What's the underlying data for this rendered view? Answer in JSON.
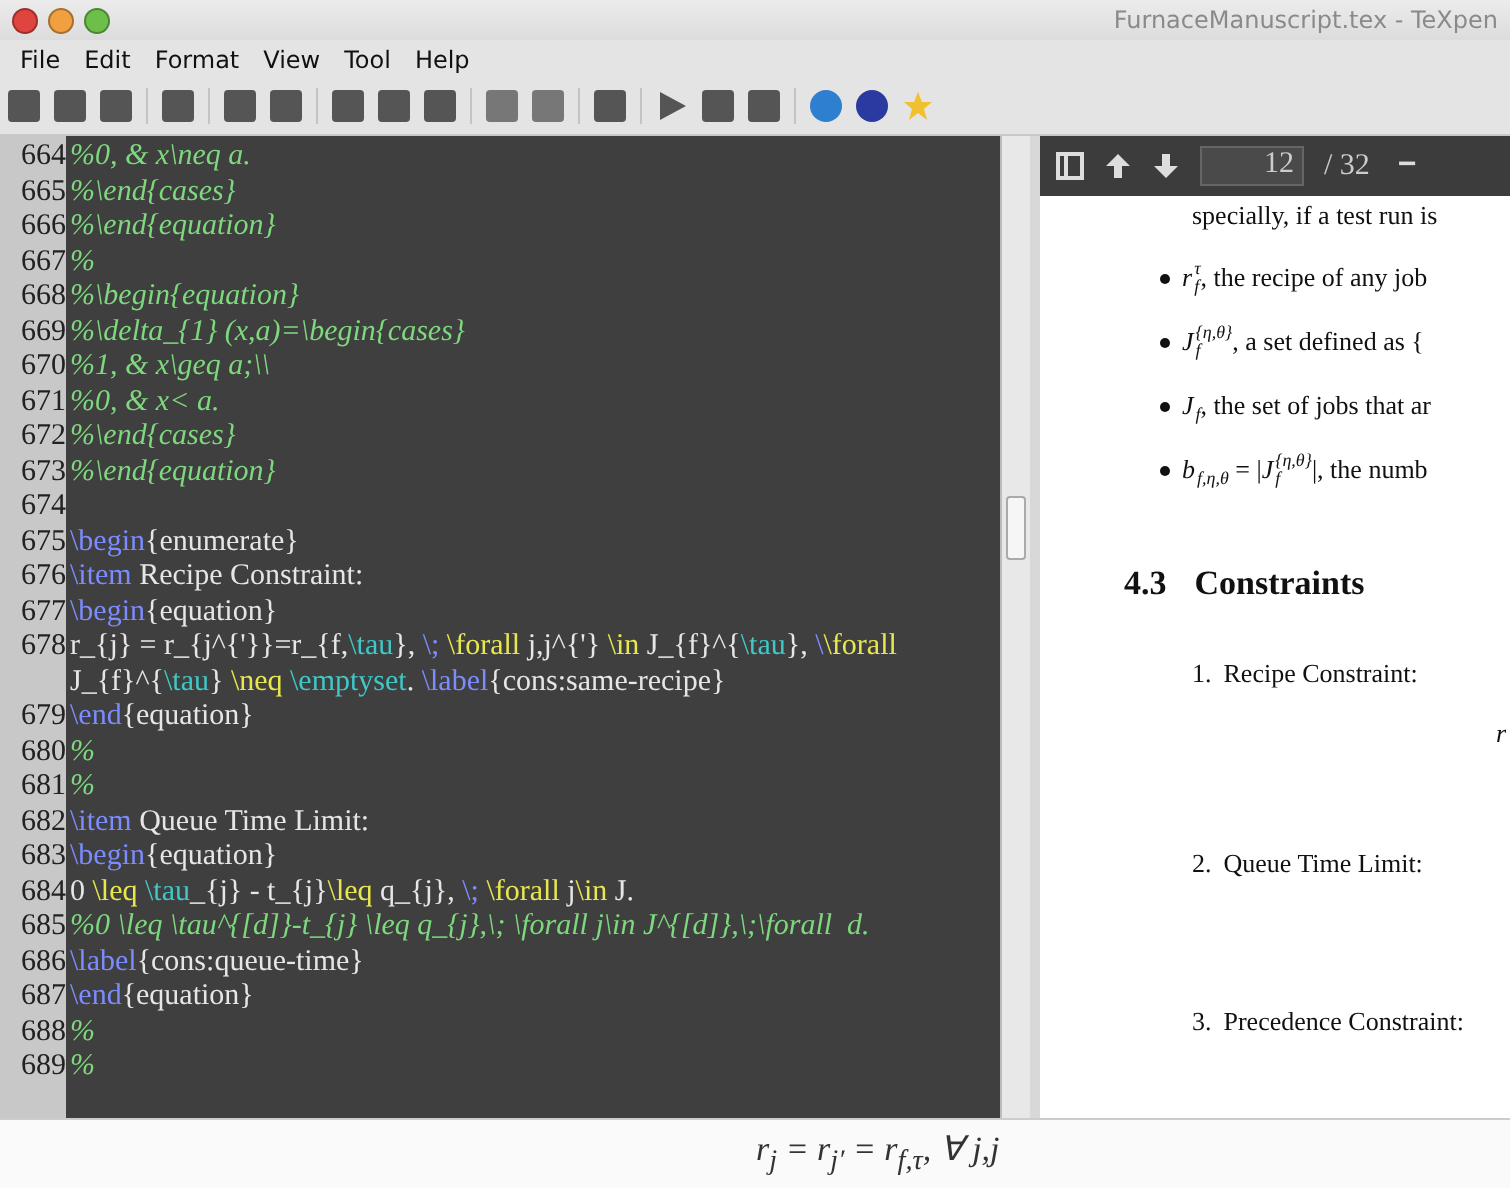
{
  "window": {
    "title": "FurnaceManuscript.tex - TeXpen"
  },
  "menu": [
    "File",
    "Edit",
    "Format",
    "View",
    "Tool",
    "Help"
  ],
  "editor": {
    "lines": [
      {
        "number": "664",
        "segments": [
          {
            "kind": "comment",
            "text": "%0, & x\\neq a."
          }
        ]
      },
      {
        "number": "665",
        "segments": [
          {
            "kind": "comment",
            "text": "%\\end{cases}"
          }
        ]
      },
      {
        "number": "666",
        "segments": [
          {
            "kind": "comment",
            "text": "%\\end{equation}"
          }
        ]
      },
      {
        "number": "667",
        "segments": [
          {
            "kind": "comment",
            "text": "%"
          }
        ]
      },
      {
        "number": "668",
        "segments": [
          {
            "kind": "comment",
            "text": "%\\begin{equation}"
          }
        ]
      },
      {
        "number": "669",
        "segments": [
          {
            "kind": "comment",
            "text": "%\\delta_{1} (x,a)=\\begin{cases}"
          }
        ]
      },
      {
        "number": "670",
        "segments": [
          {
            "kind": "comment",
            "text": "%1, & x\\geq a;\\\\"
          }
        ]
      },
      {
        "number": "671",
        "segments": [
          {
            "kind": "comment",
            "text": "%0, & x< a."
          }
        ]
      },
      {
        "number": "672",
        "segments": [
          {
            "kind": "comment",
            "text": "%\\end{cases}"
          }
        ]
      },
      {
        "number": "673",
        "segments": [
          {
            "kind": "comment",
            "text": "%\\end{equation}"
          }
        ]
      },
      {
        "number": "674"
      },
      {
        "number": "675",
        "segments": [
          {
            "kind": "keyword",
            "text": "\\begin"
          },
          {
            "kind": "plain",
            "text": "{enumerate}"
          }
        ]
      },
      {
        "number": "676",
        "segments": [
          {
            "kind": "keyword",
            "text": "\\item"
          },
          {
            "kind": "plain",
            "text": " Recipe Constraint:"
          }
        ]
      },
      {
        "number": "677",
        "segments": [
          {
            "kind": "keyword",
            "text": "\\begin"
          },
          {
            "kind": "plain",
            "text": "{equation}"
          }
        ]
      },
      {
        "number": "678",
        "segments": [
          {
            "kind": "plain",
            "text": "r_{j} = r_{j^{'}}=r_{f,"
          },
          {
            "kind": "math",
            "text": "\\tau"
          },
          {
            "kind": "plain",
            "text": "}, "
          },
          {
            "kind": "keyword",
            "text": "\\;"
          },
          {
            "kind": "command",
            "text": " \\forall"
          },
          {
            "kind": "plain",
            "text": " j,j^{'} "
          },
          {
            "kind": "command",
            "text": "\\in"
          },
          {
            "kind": "plain",
            "text": " J_{f}^{"
          },
          {
            "kind": "math",
            "text": "\\tau"
          },
          {
            "kind": "plain",
            "text": "}, "
          },
          {
            "kind": "keyword",
            "text": "\\"
          },
          {
            "kind": "command",
            "text": "\\forall"
          },
          {
            "kind": "break"
          },
          {
            "kind": "plain",
            "text": "J_{f}^{"
          },
          {
            "kind": "math",
            "text": "\\tau"
          },
          {
            "kind": "plain",
            "text": "} "
          },
          {
            "kind": "command",
            "text": "\\neq "
          },
          {
            "kind": "math",
            "text": "\\emptyset"
          },
          {
            "kind": "plain",
            "text": ". "
          },
          {
            "kind": "keyword",
            "text": "\\label"
          },
          {
            "kind": "plain",
            "text": "{cons:same-recipe}"
          }
        ]
      },
      {
        "number": "679",
        "segments": [
          {
            "kind": "keyword",
            "text": "\\end"
          },
          {
            "kind": "plain",
            "text": "{equation}"
          }
        ]
      },
      {
        "number": "680",
        "segments": [
          {
            "kind": "comment",
            "text": "%"
          }
        ]
      },
      {
        "number": "681",
        "segments": [
          {
            "kind": "comment",
            "text": "%"
          }
        ]
      },
      {
        "number": "682",
        "segments": [
          {
            "kind": "keyword",
            "text": "\\item"
          },
          {
            "kind": "plain",
            "text": " Queue Time Limit:"
          }
        ]
      },
      {
        "number": "683",
        "segments": [
          {
            "kind": "keyword",
            "text": "\\begin"
          },
          {
            "kind": "plain",
            "text": "{equation}"
          }
        ]
      },
      {
        "number": "684",
        "segments": [
          {
            "kind": "plain",
            "text": "0 "
          },
          {
            "kind": "command",
            "text": "\\leq"
          },
          {
            "kind": "math",
            "text": " \\tau"
          },
          {
            "kind": "plain",
            "text": "_{j} - t_{j}"
          },
          {
            "kind": "command",
            "text": "\\leq"
          },
          {
            "kind": "plain",
            "text": " q_{j}, "
          },
          {
            "kind": "keyword",
            "text": "\\;"
          },
          {
            "kind": "command",
            "text": " \\forall"
          },
          {
            "kind": "plain",
            "text": " j"
          },
          {
            "kind": "command",
            "text": "\\in"
          },
          {
            "kind": "plain",
            "text": " J."
          }
        ]
      },
      {
        "number": "685",
        "segments": [
          {
            "kind": "comment",
            "text": "%0 \\leq \\tau^{[d]}-t_{j} \\leq q_{j},\\; \\forall j\\in J^{[d]},\\;\\forall  d."
          }
        ]
      },
      {
        "number": "686",
        "segments": [
          {
            "kind": "keyword",
            "text": "\\label"
          },
          {
            "kind": "plain",
            "text": "{cons:queue-time}"
          }
        ]
      },
      {
        "number": "687",
        "segments": [
          {
            "kind": "keyword",
            "text": "\\end"
          },
          {
            "kind": "plain",
            "text": "{equation}"
          }
        ]
      },
      {
        "number": "688",
        "segments": [
          {
            "kind": "comment",
            "text": "%"
          }
        ]
      },
      {
        "number": "689",
        "segments": [
          {
            "kind": "comment",
            "text": "%"
          }
        ]
      }
    ]
  },
  "viewer": {
    "page": "12",
    "page_count": "/ 32",
    "zoom_out": "−",
    "intro": "specially, if a test run is",
    "bullets": [
      [
        {
          "kind": "math",
          "base": "r",
          "sup": "τ",
          "sub": "f"
        },
        {
          "kind": "text",
          "text": ", the recipe of any job"
        }
      ],
      [
        {
          "kind": "math",
          "base": "J",
          "sup": "{η,θ}",
          "sub": "f"
        },
        {
          "kind": "text",
          "text": ", a set defined as {"
        }
      ],
      [
        {
          "kind": "math",
          "base": "J",
          "sub": "f"
        },
        {
          "kind": "text",
          "text": ", the set of jobs that ar"
        }
      ],
      [
        {
          "kind": "math",
          "base": "b",
          "sub": "f,η,θ"
        },
        {
          "kind": "text",
          "text": " = |"
        },
        {
          "kind": "math",
          "base": "J",
          "sup": "{η,θ}",
          "sub": "f"
        },
        {
          "kind": "text",
          "text": "|, the numb"
        }
      ]
    ],
    "section_number": "4.3",
    "section_title": "Constraints",
    "items": [
      {
        "number": "1.",
        "text": "Recipe Constraint:",
        "formula": "r"
      },
      {
        "number": "2.",
        "text": "Queue Time Limit:"
      },
      {
        "number": "3.",
        "text": "Precedence Constraint:"
      }
    ]
  },
  "preview": {
    "formula": "r$_{j}$ = r$_{j′}$ = r$_{f,τ}$, ∀ j,j"
  }
}
